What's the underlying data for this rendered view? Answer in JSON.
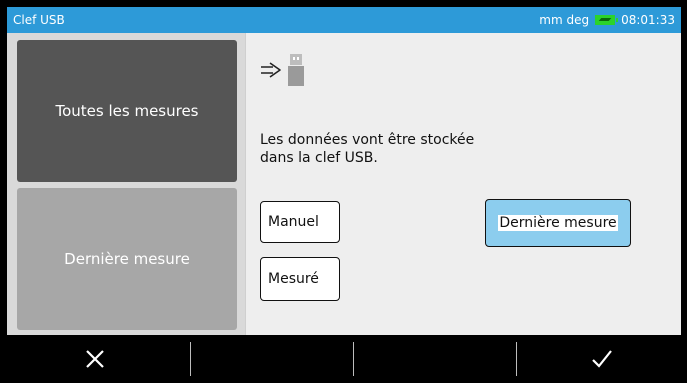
{
  "titlebar": {
    "title": "Clef USB",
    "units": "mm deg",
    "time": "08:01:33"
  },
  "sidebar": {
    "items": [
      {
        "label": "Toutes les mesures",
        "active": true
      },
      {
        "label": "Dernière mesure",
        "active": false
      }
    ]
  },
  "content": {
    "message_line1": "Les données vont être stockée",
    "message_line2": "dans la clef USB.",
    "buttons": {
      "manuel": "Manuel",
      "mesure": "Mesuré",
      "derniere": "Dernière mesure"
    }
  },
  "icons": {
    "export": "arrow-right-icon",
    "usb": "usb-drive-icon",
    "battery": "battery-icon",
    "cancel": "close-icon",
    "confirm": "checkmark-icon"
  },
  "colors": {
    "titlebar": "#2d9ad8",
    "selected_button": "#8ccdee",
    "active_side": "#555555",
    "inactive_side": "#a7a7a7",
    "battery": "#2bd32b"
  }
}
